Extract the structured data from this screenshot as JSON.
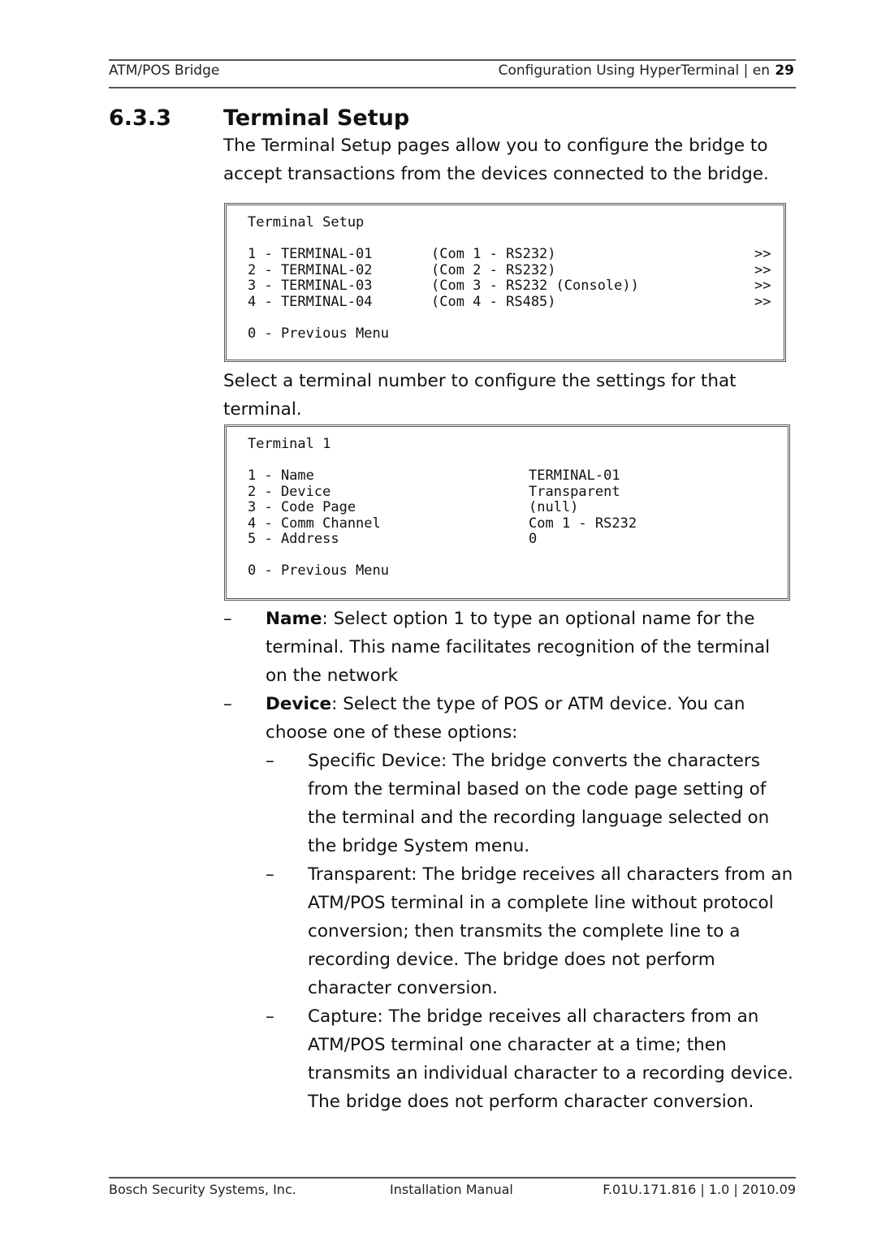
{
  "header": {
    "left": "ATM/POS Bridge",
    "right": "Configuration Using HyperTerminal | en",
    "page_number": "29"
  },
  "section": {
    "number": "6.3.3",
    "title": "Terminal Setup",
    "intro": "The Terminal Setup pages allow you to configure the bridge to accept transactions from the devices connected to the bridge."
  },
  "terminal_setup_screen": {
    "title": "Terminal Setup",
    "rows": [
      {
        "option": "1 - TERMINAL-01",
        "channel": "(Com 1 - RS232)",
        "arrow": ">>"
      },
      {
        "option": "2 - TERMINAL-02",
        "channel": "(Com 2 - RS232)",
        "arrow": ">>"
      },
      {
        "option": "3 - TERMINAL-03",
        "channel": "(Com 3 - RS232 (Console))",
        "arrow": ">>"
      },
      {
        "option": "4 - TERMINAL-04",
        "channel": "(Com 4 - RS485)",
        "arrow": ">>"
      }
    ],
    "previous": "0 - Previous Menu"
  },
  "select_text": "Select a terminal number to configure the settings for that terminal.",
  "terminal1_screen": {
    "title": "Terminal 1",
    "rows": [
      {
        "option": "1 - Name",
        "value": "TERMINAL-01"
      },
      {
        "option": "2 - Device",
        "value": "Transparent"
      },
      {
        "option": "3 - Code Page",
        "value": "(null)"
      },
      {
        "option": "4 - Comm Channel",
        "value": "Com 1 - RS232"
      },
      {
        "option": "5 - Address",
        "value": "0"
      }
    ],
    "previous": "0 - Previous Menu"
  },
  "bullets": {
    "dash": "–",
    "name": {
      "term": "Name",
      "text": ": Select option 1 to type an optional name for the terminal. This name facilitates recognition of the terminal on the network"
    },
    "device": {
      "term": "Device",
      "text": ": Select the type of POS or ATM device. You can choose one of these options:"
    },
    "sub": [
      "Specific Device: The bridge converts the characters from the terminal based on the code page setting of the terminal and the recording language selected on the bridge System menu.",
      "Transparent: The bridge receives all characters from an ATM/POS terminal in a complete line without protocol conversion; then transmits the complete line to a recording device. The bridge does not perform character conversion.",
      "Capture: The bridge receives all characters from an ATM/POS terminal one character at a time; then transmits an individual character to a recording device. The bridge does not perform character conversion."
    ]
  },
  "footer": {
    "left": "Bosch Security Systems, Inc.",
    "center": "Installation Manual",
    "right": "F.01U.171.816 | 1.0 | 2010.09"
  }
}
